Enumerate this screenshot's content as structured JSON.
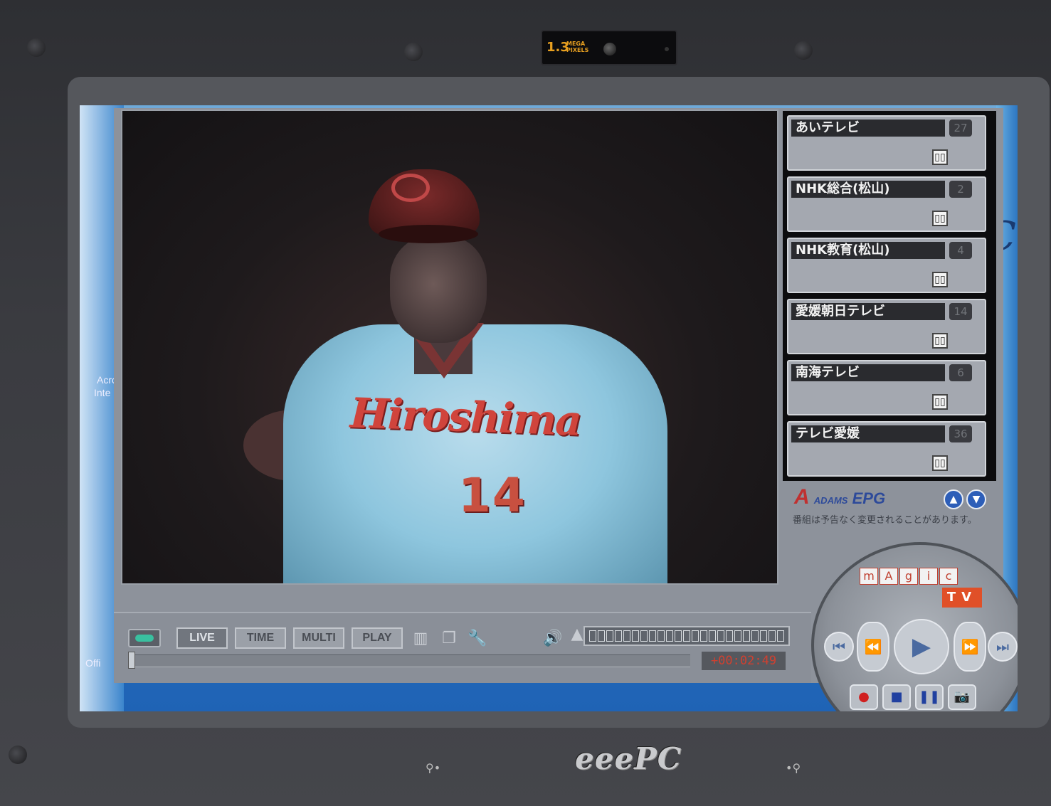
{
  "device": {
    "webcam_label": "1.3",
    "webcam_sub": "MEGA PIXELS",
    "brand": "eeePC"
  },
  "desktop": {
    "icon_labels": [
      "Acro",
      "Inte",
      "Offi"
    ],
    "right_text": "C"
  },
  "player": {
    "jersey_text": "Hiroshima",
    "jersey_number": "14",
    "modes": [
      "LIVE",
      "TIME",
      "MULTI",
      "PLAY"
    ],
    "active_mode": "LIVE",
    "timecode": "+00:02:49"
  },
  "channels": [
    {
      "name": "あいテレビ",
      "number": "27"
    },
    {
      "name": "NHK総合(松山)",
      "number": "2"
    },
    {
      "name": "NHK教育(松山)",
      "number": "4"
    },
    {
      "name": "愛媛朝日テレビ",
      "number": "14"
    },
    {
      "name": "南海テレビ",
      "number": "6"
    },
    {
      "name": "テレビ愛媛",
      "number": "36"
    }
  ],
  "epg": {
    "logo_top": "ADAMS",
    "logo_bottom": "EPG",
    "note": "番組は予告なく変更されることがあります。"
  },
  "remote": {
    "magic_letters": [
      "m",
      "A",
      "g",
      "i",
      "c"
    ],
    "tv_label": "TV"
  }
}
